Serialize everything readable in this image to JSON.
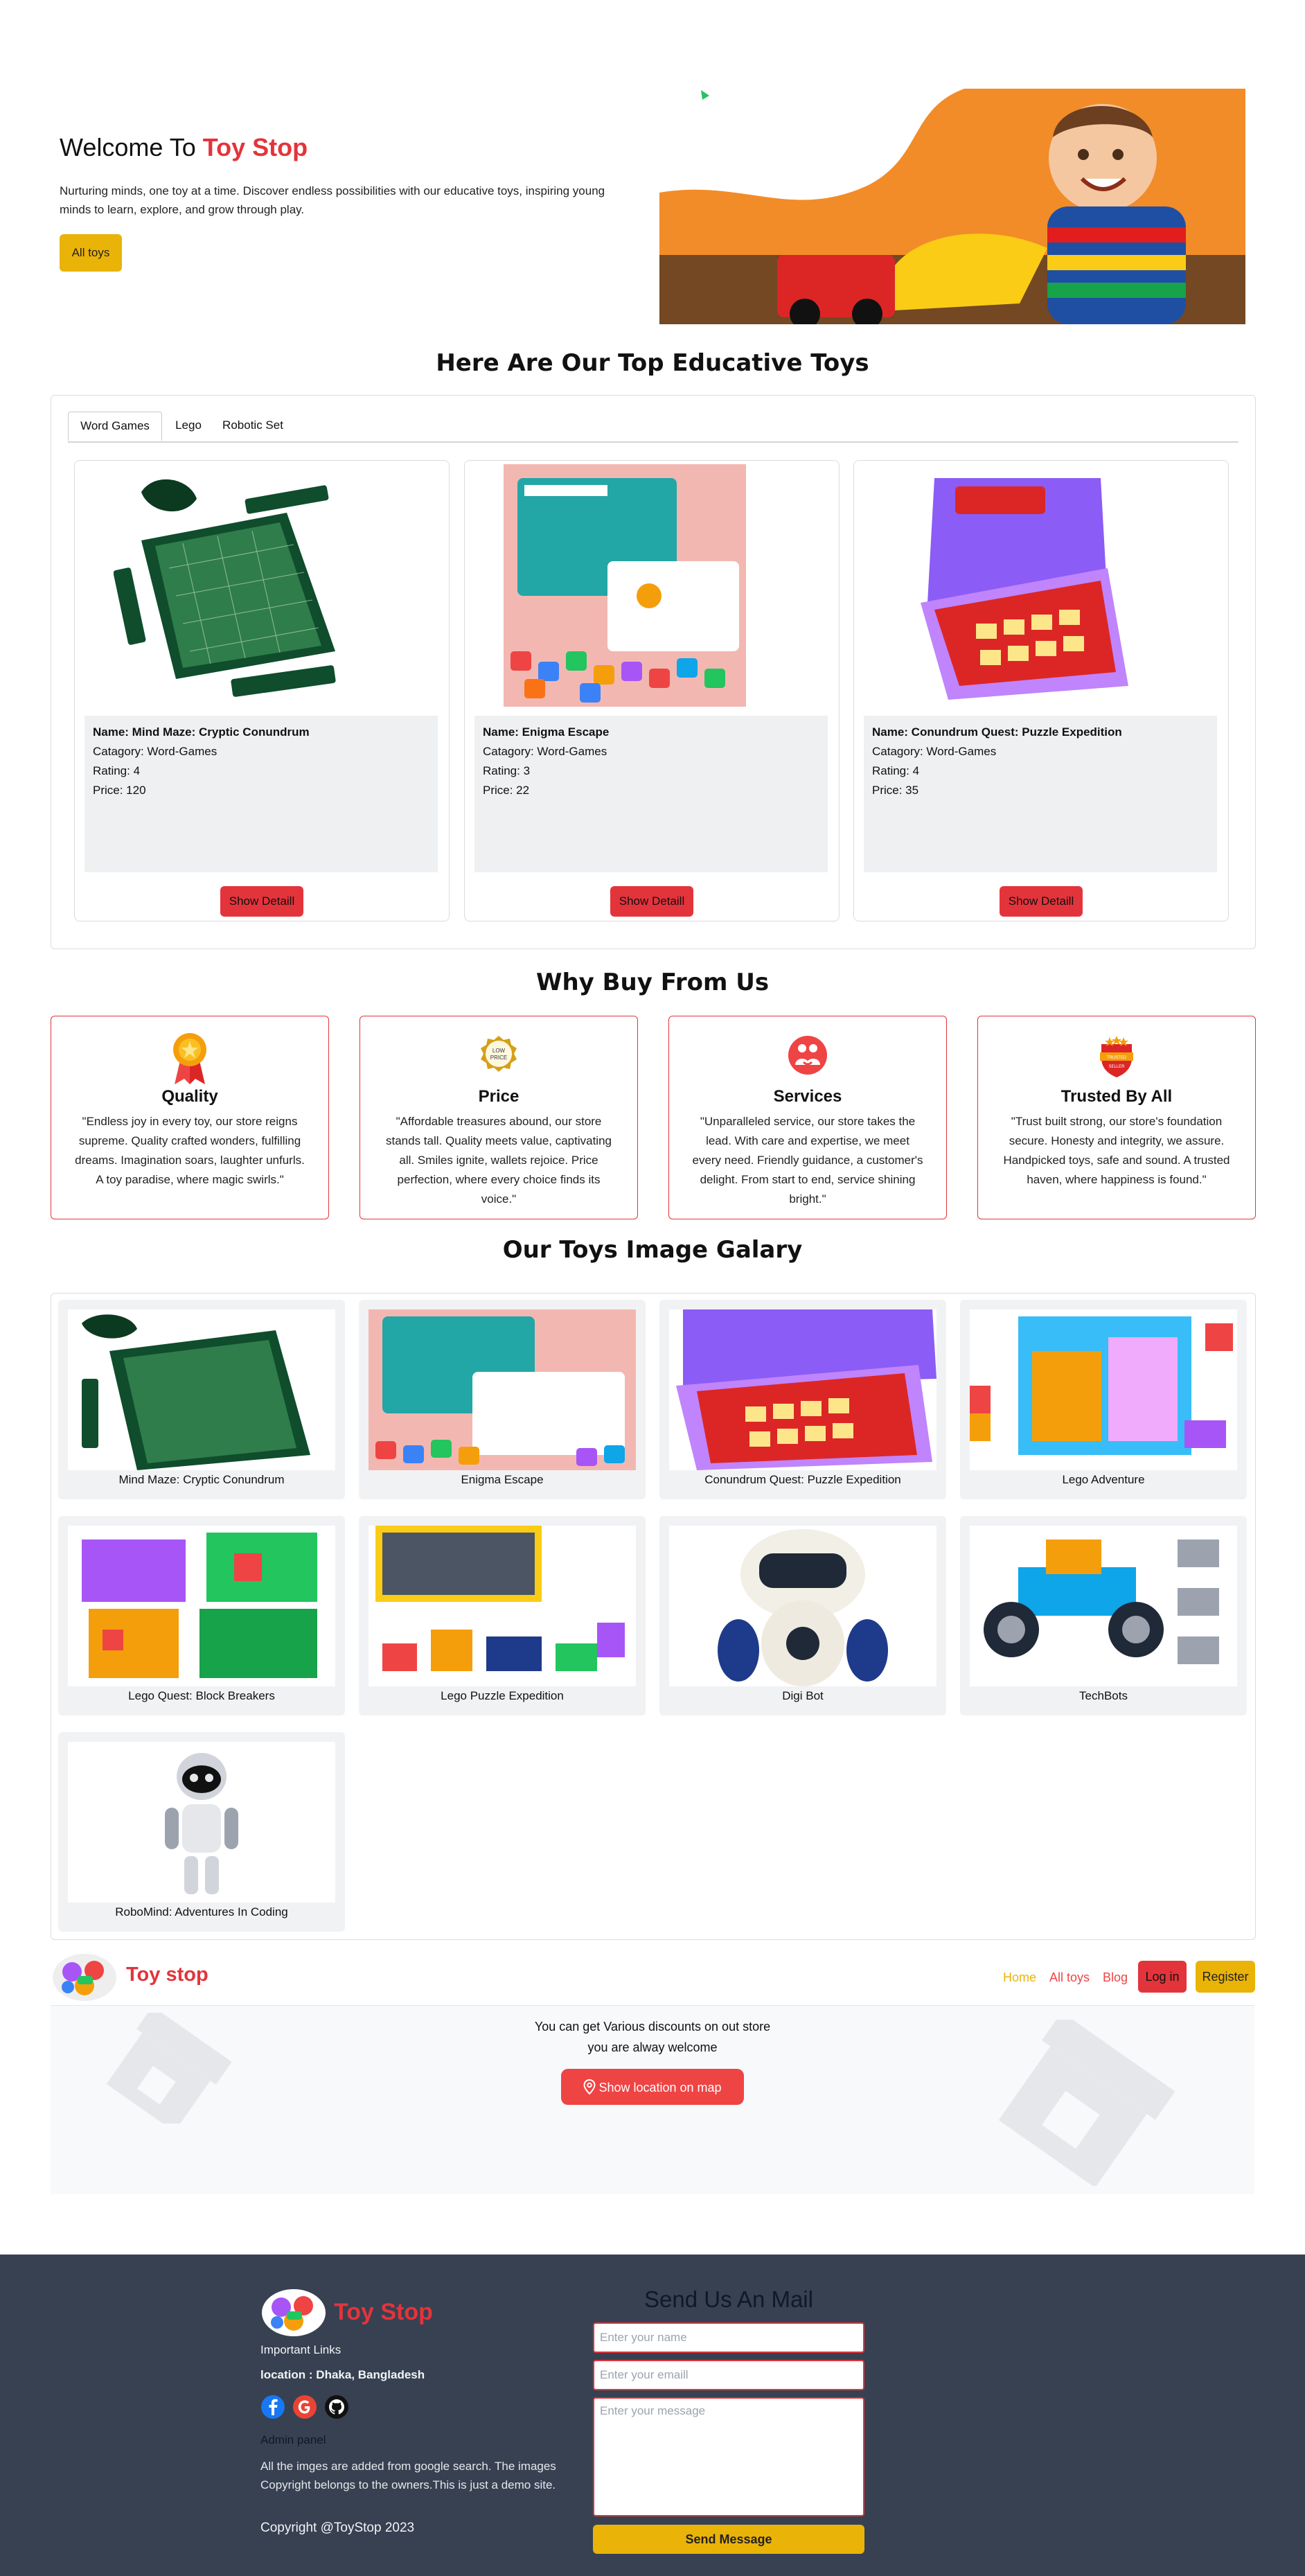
{
  "hero": {
    "title_prefix": "Welcome To",
    "title_brand": "Toy Stop",
    "text": "Nurturing minds, one toy at a time. Discover endless possibilities with our educative toys, inspiring young minds to learn, explore, and grow through play.",
    "button": "All toys"
  },
  "tabs_section": {
    "title": "Here Are Our Top Educative Toys",
    "tabs": [
      "Word Games",
      "Lego",
      "Robotic Set"
    ],
    "active_tab": "Word Games",
    "cards": [
      {
        "name": "Name: Mind Maze: Cryptic Conundrum",
        "category": "Catagory: Word-Games",
        "rating": "Rating: 4",
        "price": "Price: 120",
        "button": "Show Detaill"
      },
      {
        "name": "Name: Enigma Escape",
        "category": "Catagory: Word-Games",
        "rating": "Rating: 3",
        "price": "Price: 22",
        "button": "Show Detaill"
      },
      {
        "name": "Name: Conundrum Quest: Puzzle Expedition",
        "category": "Catagory: Word-Games",
        "rating": "Rating: 4",
        "price": "Price: 35",
        "button": "Show Detaill"
      }
    ]
  },
  "why": {
    "title": "Why Buy From Us",
    "items": [
      {
        "title": "Quality",
        "icon": "medal-icon",
        "text": "\"Endless joy in every toy, our store reigns supreme. Quality crafted wonders, fulfilling dreams. Imagination soars, laughter unfurls. A toy paradise, where magic swirls.\""
      },
      {
        "title": "Price",
        "icon": "low-price-badge-icon",
        "icon_text": "LOW PRICE",
        "text": "\"Affordable treasures abound, our store stands tall. Quality meets value, captivating all. Smiles ignite, wallets rejoice. Price perfection, where every choice finds its voice.\""
      },
      {
        "title": "Services",
        "icon": "service-people-icon",
        "text": "\"Unparalleled service, our store takes the lead. With care and expertise, we meet every need. Friendly guidance, a customer's delight. From start to end, service shining bright.\""
      },
      {
        "title": "Trusted By All",
        "icon": "trusted-seller-icon",
        "icon_text": "TRUSTED SELLER",
        "text": "\"Trust built strong, our store's foundation secure. Honesty and integrity, we assure. Handpicked toys, safe and sound. A trusted haven, where happiness is found.\""
      }
    ]
  },
  "gallery": {
    "title": "Our Toys Image Galary",
    "items": [
      "Mind Maze: Cryptic Conundrum",
      "Enigma Escape",
      "Conundrum Quest: Puzzle Expedition",
      "Lego Adventure",
      "Lego Quest: Block Breakers",
      "Lego Puzzle Expedition",
      "Digi Bot",
      "TechBots",
      "RoboMind: Adventures In Coding"
    ]
  },
  "nav": {
    "brand": "Toy stop",
    "links": [
      "Home",
      "All toys",
      "Blog"
    ],
    "login": "Log in",
    "register": "Register"
  },
  "banner": {
    "line1": "You can get Various discounts on out store",
    "line2": "you are alway welcome",
    "button": "Show location on map"
  },
  "footer": {
    "brand": "Toy Stop",
    "important_links": "Important Links",
    "location_label": "location :",
    "location_value": "Dhaka, Bangladesh",
    "admin": "Admin panel",
    "note": "All the imges are added from google search. The images Copyright belongs to the owners.This is just a demo site.",
    "copyright": "Copyright @ToyStop 2023",
    "mail_title": "Send Us An Mail",
    "name_placeholder": "Enter your name",
    "email_placeholder": "Enter your emaill",
    "message_placeholder": "Enter your message",
    "send": "Send Message"
  },
  "colors": {
    "brand_red": "#e3343b",
    "accent_yellow": "#eab308",
    "footer_bg": "#374151",
    "hero_orange": "#f28c28"
  }
}
